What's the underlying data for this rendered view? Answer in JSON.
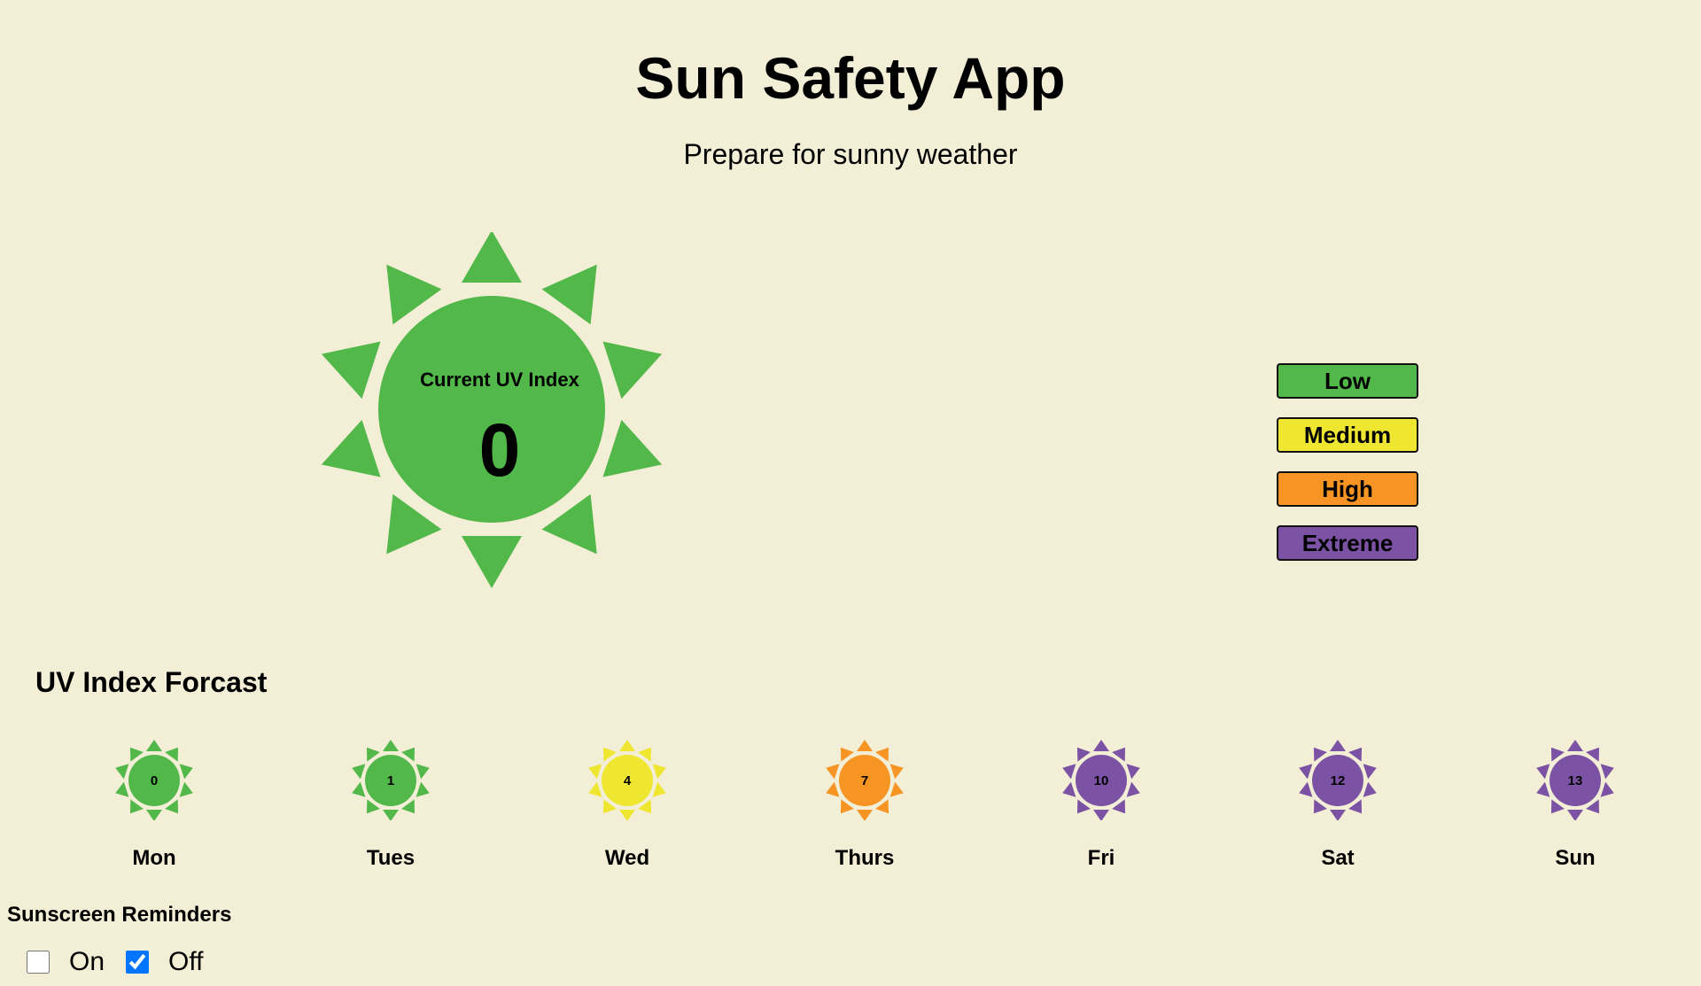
{
  "header": {
    "title": "Sun Safety App",
    "subtitle": "Prepare for sunny weather"
  },
  "current": {
    "label": "Current UV Index",
    "value": "0",
    "color": "#52b84a"
  },
  "legend": [
    {
      "label": "Low",
      "color": "#52b84a"
    },
    {
      "label": "Medium",
      "color": "#efe631"
    },
    {
      "label": "High",
      "color": "#f69523"
    },
    {
      "label": "Extreme",
      "color": "#7b52a4"
    }
  ],
  "forecast": {
    "title": "UV Index Forcast",
    "days": [
      {
        "day": "Mon",
        "value": "0",
        "color": "#52b84a"
      },
      {
        "day": "Tues",
        "value": "1",
        "color": "#52b84a"
      },
      {
        "day": "Wed",
        "value": "4",
        "color": "#efe631"
      },
      {
        "day": "Thurs",
        "value": "7",
        "color": "#f69523"
      },
      {
        "day": "Fri",
        "value": "10",
        "color": "#7b52a4"
      },
      {
        "day": "Sat",
        "value": "12",
        "color": "#7b52a4"
      },
      {
        "day": "Sun",
        "value": "13",
        "color": "#7b52a4"
      }
    ]
  },
  "reminders": {
    "title": "Sunscreen Reminders",
    "on_label": "On",
    "off_label": "Off",
    "on_checked": false,
    "off_checked": true
  }
}
